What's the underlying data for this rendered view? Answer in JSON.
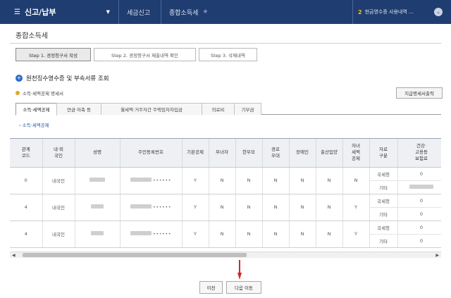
{
  "topbar": {
    "menu_label": "신고/납부",
    "menu_icon": "hamburger-icon",
    "crumb1": "세금신고",
    "crumb2": "종합소득세",
    "star_icon": "star-icon",
    "right_num": "2",
    "right_text": "현금영수증 사용내역 ...",
    "bg_color": "#1f3d70"
  },
  "page": {
    "title": "종합소득세"
  },
  "steps": [
    {
      "label": "Step 1. 경정청구서 작성",
      "active": true
    },
    {
      "label": "Step 2. 경정청구서 제출내역 확인",
      "active": false
    },
    {
      "label": "Step 3. 삭제내역",
      "active": false
    }
  ],
  "section": {
    "heading": "원천징수영수증 및 부속서류 조회",
    "sub_heading": "소득·세액공제 명세서",
    "print_button": "지급명세서출력"
  },
  "category_tabs": [
    {
      "label": "소득·세액공제",
      "active": true
    },
    {
      "label": "연금·저축 등",
      "active": false
    },
    {
      "label": "월세액·거주자간 주택임차차입금",
      "active": false
    },
    {
      "label": "의료비",
      "active": false
    },
    {
      "label": "기부금",
      "active": false
    }
  ],
  "link": "› 소득·세액공제",
  "table": {
    "headers": [
      "관계\n코드",
      "내·외\n국인",
      "성명",
      "주민등록번호",
      "기본공제",
      "부녀자",
      "한부모",
      "경로\n우대",
      "장애인",
      "출산입양",
      "자녀\n세액\n공제",
      "자료\n구분",
      "건강·\n고용등\n보험료"
    ],
    "rows": [
      {
        "code": "0",
        "nation": "내국인",
        "ssn_mask": "••••••",
        "basic": "Y",
        "woman": "N",
        "single": "N",
        "elder": "N",
        "disabled": "N",
        "birth": "N",
        "child": "N",
        "kind1": "국세청",
        "ins1": "0",
        "kind2": "기타",
        "ins2": ""
      },
      {
        "code": "4",
        "nation": "내국인",
        "ssn_mask": "••••••",
        "basic": "Y",
        "woman": "N",
        "single": "N",
        "elder": "N",
        "disabled": "N",
        "birth": "N",
        "child": "Y",
        "kind1": "국세청",
        "ins1": "0",
        "kind2": "기타",
        "ins2": "0"
      },
      {
        "code": "4",
        "nation": "내국인",
        "ssn_mask": "••••••",
        "basic": "Y",
        "woman": "N",
        "single": "N",
        "elder": "N",
        "disabled": "N",
        "birth": "N",
        "child": "Y",
        "kind1": "국세청",
        "ins1": "0",
        "kind2": "기타",
        "ins2": "0"
      }
    ]
  },
  "buttons": {
    "prev": "이전",
    "next": "다음 이동"
  },
  "colors": {
    "accent_blue": "#2b6cc4",
    "arrow_red": "#d9261c",
    "bullet_orange": "#e6a52b"
  }
}
